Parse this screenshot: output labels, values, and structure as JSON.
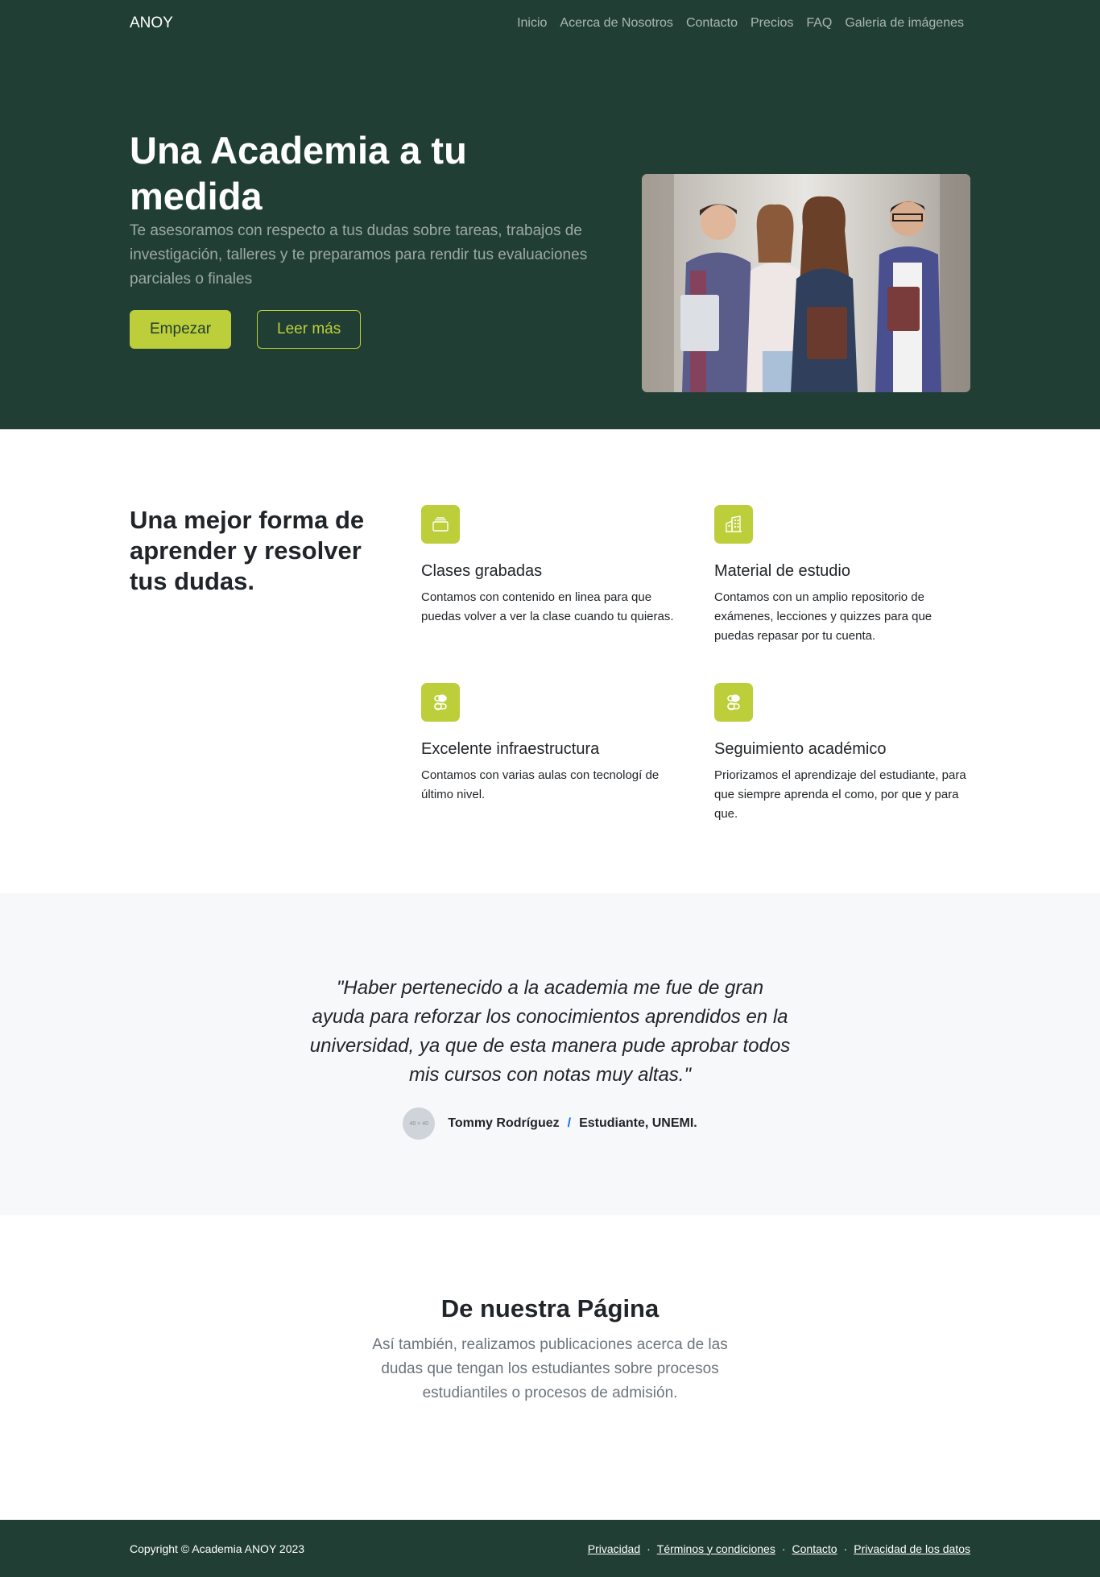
{
  "nav": {
    "brand": "ANOY",
    "links": [
      "Inicio",
      "Acerca de Nosotros",
      "Contacto",
      "Precios",
      "FAQ",
      "Galeria de imágenes"
    ]
  },
  "hero": {
    "title": "Una Academia a tu medida",
    "lead": "Te asesoramos con respecto a tus dudas sobre tareas, trabajos de investigación, talleres y te preparamos para rendir tus evaluaciones parciales o finales",
    "primary_button": "Empezar",
    "secondary_button": "Leer más"
  },
  "features": {
    "title": "Una mejor forma de aprender y resolver tus dudas.",
    "items": [
      {
        "icon": "collection-icon",
        "title": "Clases grabadas",
        "text": "Contamos con contenido en linea para que puedas volver a ver la clase cuando tu quieras."
      },
      {
        "icon": "building-icon",
        "title": "Material de estudio",
        "text": "Contamos con un amplio repositorio de exámenes, lecciones y quizzes para que puedas repasar por tu cuenta."
      },
      {
        "icon": "toggles-icon",
        "title": "Excelente infraestructura",
        "text": "Contamos con varias aulas con tecnologí de último nivel."
      },
      {
        "icon": "toggles-icon",
        "title": "Seguimiento académico",
        "text": "Priorizamos el aprendizaje del estudiante, para que siempre aprenda el como, por que y para que."
      }
    ]
  },
  "testimonial": {
    "quote": "\"Haber pertenecido a la academia me fue de gran ayuda para reforzar los conocimientos aprendidos en la universidad, ya que de esta manera pude aprobar todos mis cursos con notas muy altas.\"",
    "avatar_label": "40 × 40",
    "name": "Tommy Rodríguez",
    "separator": "/",
    "role": "Estudiante, UNEMI."
  },
  "blog": {
    "title": "De nuestra Página",
    "lead": "Así también, realizamos publicaciones acerca de las dudas que tengan los estudiantes sobre procesos estudiantiles o procesos de admisión."
  },
  "footer": {
    "copyright": "Copyright © Academia ANOY 2023",
    "links": [
      "Privacidad",
      "Términos y condiciones",
      "Contacto",
      "Privacidad de los datos"
    ],
    "separator": "·"
  },
  "colors": {
    "primary_dark": "#213e34",
    "accent": "#bccf3a"
  }
}
